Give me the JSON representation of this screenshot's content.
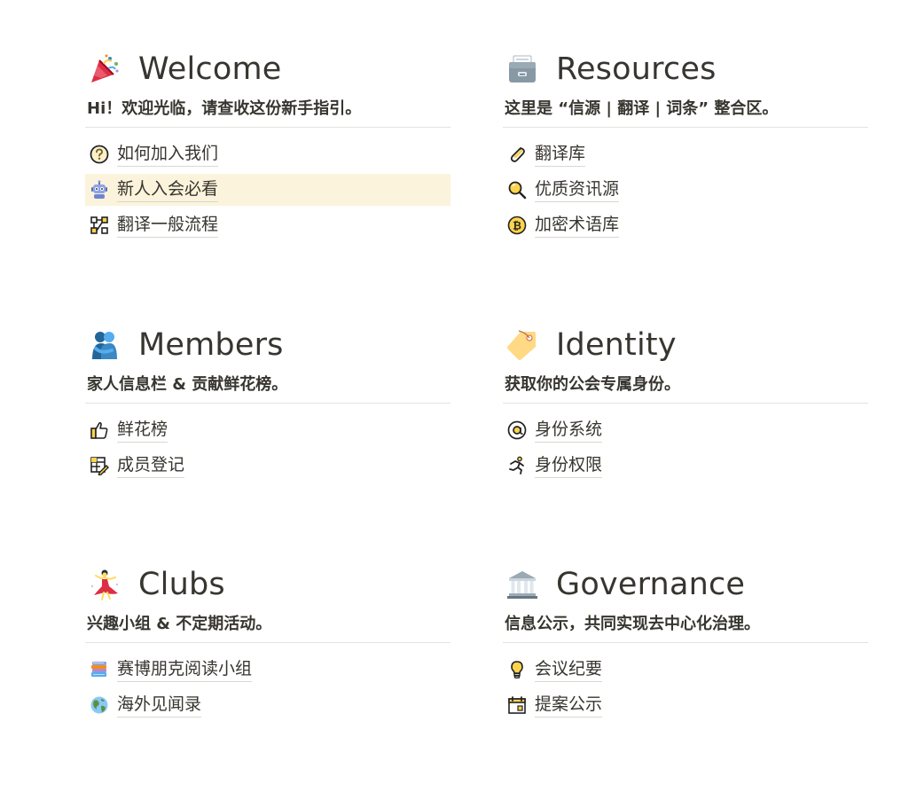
{
  "sections": {
    "welcome": {
      "icon": "party-popper-icon",
      "title": "Welcome",
      "description": "Hi！欢迎光临，请查收这份新手指引。",
      "links": [
        {
          "label": "如何加入我们",
          "icon": "question-circle-icon"
        },
        {
          "label": "新人入会必看",
          "icon": "robot-icon",
          "highlighted": true
        },
        {
          "label": "翻译一般流程",
          "icon": "flowchart-icon"
        }
      ]
    },
    "resources": {
      "icon": "card-file-box-icon",
      "title": "Resources",
      "description": "这里是 “信源 | 翻译 | 词条” 整合区。",
      "links": [
        {
          "label": "翻译库",
          "icon": "paperclip-icon"
        },
        {
          "label": "优质资讯源",
          "icon": "magnifier-icon"
        },
        {
          "label": "加密术语库",
          "icon": "bitcoin-icon"
        }
      ]
    },
    "members": {
      "icon": "people-hugging-icon",
      "title": "Members",
      "description": "家人信息栏 & 贡献鲜花榜。",
      "links": [
        {
          "label": "鲜花榜",
          "icon": "thumbs-up-icon"
        },
        {
          "label": "成员登记",
          "icon": "table-edit-icon"
        }
      ]
    },
    "identity": {
      "icon": "label-tag-icon",
      "title": "Identity",
      "description": "获取你的公会专属身份。",
      "links": [
        {
          "label": "身份系统",
          "icon": "at-sign-icon"
        },
        {
          "label": "身份权限",
          "icon": "person-running-icon"
        }
      ]
    },
    "clubs": {
      "icon": "woman-dancing-icon",
      "title": "Clubs",
      "description": "兴趣小组 & 不定期活动。",
      "links": [
        {
          "label": "赛博朋克阅读小组",
          "icon": "books-icon"
        },
        {
          "label": "海外见闻录",
          "icon": "globe-icon"
        }
      ]
    },
    "governance": {
      "icon": "classical-building-icon",
      "title": "Governance",
      "description": "信息公示，共同实现去中心化治理。",
      "links": [
        {
          "label": "会议纪要",
          "icon": "lightbulb-icon"
        },
        {
          "label": "提案公示",
          "icon": "calendar-icon"
        }
      ]
    }
  },
  "colors": {
    "text": "#37352f",
    "divider": "#e3e2e0",
    "highlight": "#fbf3db",
    "accent_yellow": "#fcd34d"
  }
}
